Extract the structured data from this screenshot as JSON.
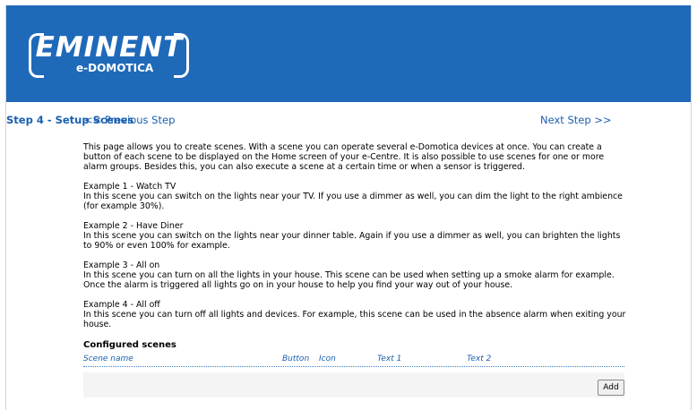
{
  "brand": {
    "logo_text": "EMINENT",
    "logo_subtext": "e-DOMOTICA",
    "header_color": "#1f69b9"
  },
  "nav": {
    "prev_label": "<<  Previous Step",
    "title": "Step 4 - Setup Scenes",
    "next_label": "Next Step  >>"
  },
  "intro": "This page allows you to create scenes. With a scene you can operate several e-Domotica devices at once. You can create a button of each scene to be displayed on the Home screen of your e-Centre. It is also possible to use scenes for one or more alarm groups. Besides this, you can also execute a scene at a certain time or when a sensor is triggered.",
  "examples": [
    {
      "title": "Example 1 - Watch TV",
      "text": "In this scene you can switch on the lights near your TV. If you use a dimmer as well, you can dim the light to the right ambience (for example 30%)."
    },
    {
      "title": "Example 2 - Have Diner",
      "text": "In this scene you can switch on the lights near your dinner table. Again if you use a dimmer as well, you can brighten the lights to 90% or even 100% for example."
    },
    {
      "title": "Example 3 - All on",
      "text": "In this scene you can turn on all the lights in your house. This scene can be used when setting up a smoke alarm for example. Once the alarm is triggered all lights go on in your house to help you find your way out of your house."
    },
    {
      "title": "Example 4 - All off",
      "text": "In this scene you can turn off all lights and devices. For example, this scene can be used in the absence alarm when exiting your house."
    }
  ],
  "configured": {
    "heading": "Configured scenes",
    "columns": [
      "Scene name",
      "Button",
      "Icon",
      "Text 1",
      "Text 2"
    ],
    "add_label": "Add"
  }
}
